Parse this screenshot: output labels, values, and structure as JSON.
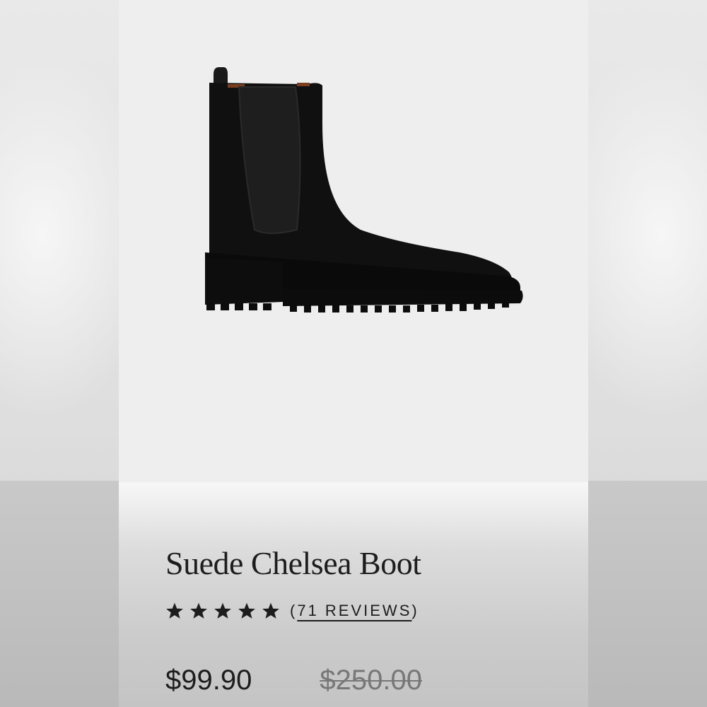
{
  "product": {
    "title": "Suede Chelsea Boot",
    "image_icon": "black-suede-chelsea-boot-image",
    "rating": {
      "stars": 5,
      "stars_filled": 5,
      "reviews_open": "(",
      "reviews_text": "71 REVIEWS",
      "reviews_close": ")"
    },
    "price": {
      "current": "$99.90",
      "original": "$250.00"
    }
  },
  "colors": {
    "text": "#1d1d1d",
    "strikethrough_price": "#777777",
    "image_background": "#eeeeee"
  }
}
